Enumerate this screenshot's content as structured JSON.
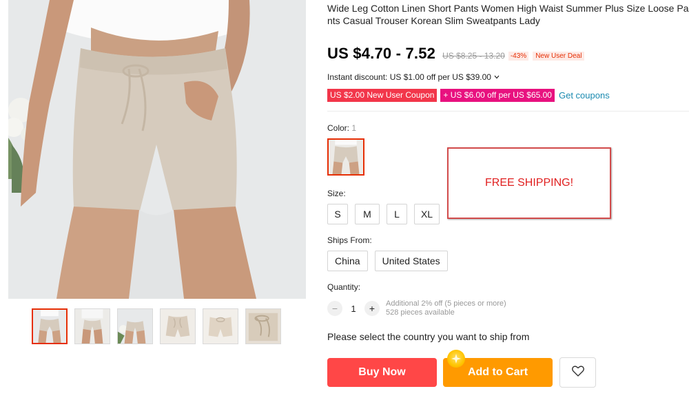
{
  "product": {
    "title": "Wide Leg Cotton Linen Short Pants Women High Waist Summer Plus Size Loose Pants Casual Trouser Korean Slim Sweatpants Lady",
    "price": "US $4.70 - 7.52",
    "original_price": "US $8.25 - 13.20",
    "discount": "-43%",
    "new_user_tag": "New User Deal",
    "instant_discount": "Instant discount: US $1.00 off per US $39.00",
    "coupons": [
      "US $2.00 New User Coupon",
      "+ US $6.00 off per US $65.00"
    ],
    "get_coupons": "Get coupons"
  },
  "color": {
    "label": "Color:",
    "count": "1"
  },
  "size": {
    "label": "Size:",
    "options": [
      "S",
      "M",
      "L",
      "XL"
    ]
  },
  "ships_from": {
    "label": "Ships From:",
    "options": [
      "China",
      "United States"
    ]
  },
  "quantity": {
    "label": "Quantity:",
    "value": "1",
    "minus": "−",
    "plus": "+",
    "note_line1": "Additional 2% off (5 pieces or more)",
    "note_line2": "528 pieces available"
  },
  "ship_message": "Please select the country you want to ship from",
  "actions": {
    "buy_now": "Buy Now",
    "add_to_cart": "Add to Cart"
  },
  "overlay": {
    "free_shipping": "FREE SHIPPING!"
  },
  "icons": {
    "wishlist": "heart-icon",
    "cart_badge": "sparkle-badge-icon",
    "expand": "chevron-down-icon"
  },
  "colors": {
    "buy_now": "#ff4747",
    "add_to_cart": "#ff9a00",
    "coupon_red": "#f2364a",
    "coupon_pink": "#e8117f",
    "link": "#1a8ab0",
    "selected_border": "#e62e04"
  }
}
